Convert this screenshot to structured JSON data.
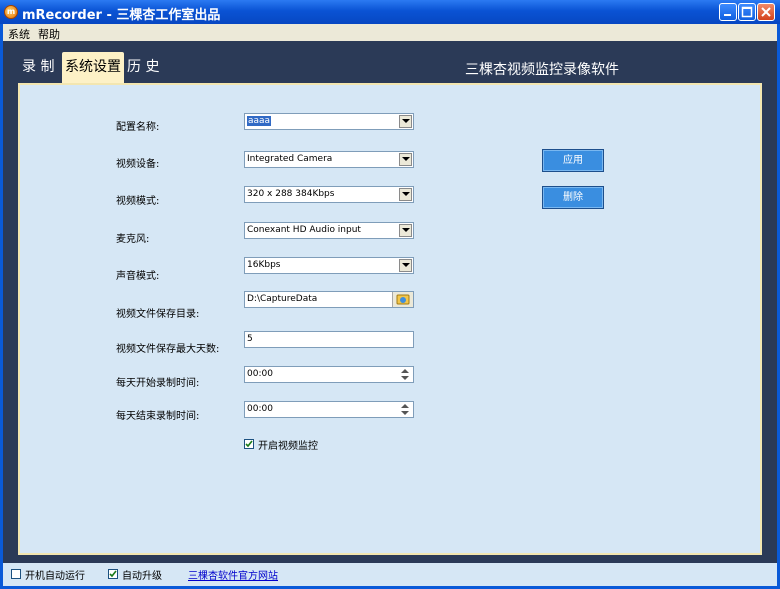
{
  "window": {
    "title": "mRecorder - 三棵杏工作室出品",
    "icon_name": "app-icon",
    "buttons": [
      "minimize-icon",
      "maximize-icon",
      "close-icon"
    ]
  },
  "menu": [
    "系统",
    "帮助"
  ],
  "tabs": [
    "录 制",
    "系统设置",
    "历 史"
  ],
  "active_tab": "系统设置",
  "product_title": "三棵杏视频监控录像软件",
  "form": {
    "config_name": {
      "label": "配置名称:",
      "value": "aaaa"
    },
    "video_device": {
      "label": "视频设备:",
      "value": "Integrated Camera"
    },
    "video_mode": {
      "label": "视频模式:",
      "value": "320 x 288 384Kbps"
    },
    "microphone": {
      "label": "麦克风:",
      "value": "Conexant HD Audio input"
    },
    "audio_mode": {
      "label": "声音模式:",
      "value": "16Kbps"
    },
    "save_dir": {
      "label": "视频文件保存目录:",
      "value": "D:\\CaptureData"
    },
    "max_days": {
      "label": "视频文件保存最大天数:",
      "value": "5"
    },
    "start_time": {
      "label": "每天开始录制时间:",
      "value": "00:00"
    },
    "end_time": {
      "label": "每天结束录制时间:",
      "value": "00:00"
    },
    "enable_monitor": {
      "label": "开启视频监控",
      "checked": true
    }
  },
  "buttons": {
    "apply": "应用",
    "delete": "删除"
  },
  "status": {
    "autostart": {
      "label": "开机自动运行",
      "checked": false
    },
    "autoupdate": {
      "label": "自动升级",
      "checked": true
    },
    "website_link": "三棵杏软件官方网站"
  },
  "colors": {
    "titlebar": "#0a53d4",
    "panel": "#d6e7f5",
    "client": "#2b3a57",
    "button": "#3a8ee0"
  }
}
